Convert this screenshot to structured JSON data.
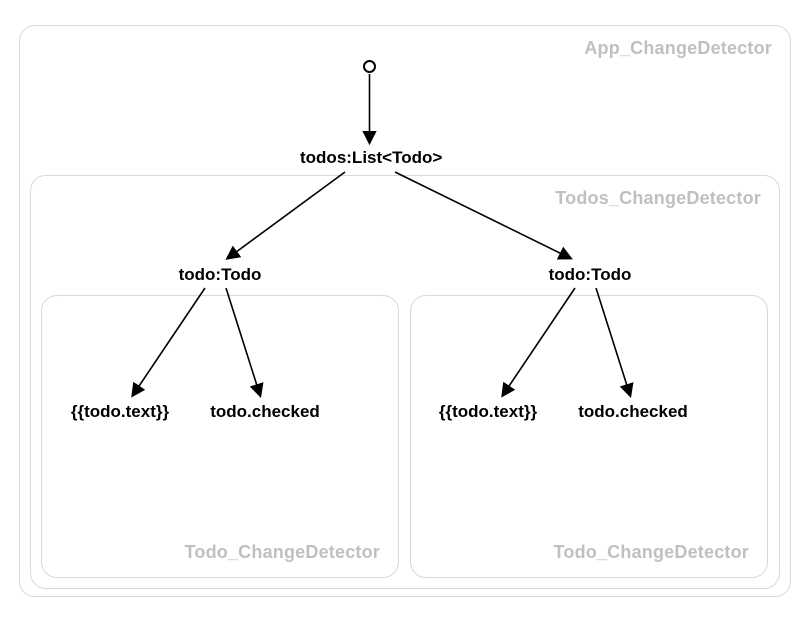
{
  "boxes": {
    "app": {
      "label": "App_ChangeDetector"
    },
    "todos": {
      "label": "Todos_ChangeDetector"
    },
    "todoL": {
      "label": "Todo_ChangeDetector"
    },
    "todoR": {
      "label": "Todo_ChangeDetector"
    }
  },
  "nodes": {
    "root": {
      "label": ""
    },
    "todosList": {
      "label": "todos:List<Todo>"
    },
    "todoLeft": {
      "label": "todo:Todo"
    },
    "todoRight": {
      "label": "todo:Todo"
    },
    "leafLL": {
      "label": "{{todo.text}}"
    },
    "leafLR": {
      "label": "todo.checked"
    },
    "leafRL": {
      "label": "{{todo.text}}"
    },
    "leafRR": {
      "label": "todo.checked"
    }
  }
}
